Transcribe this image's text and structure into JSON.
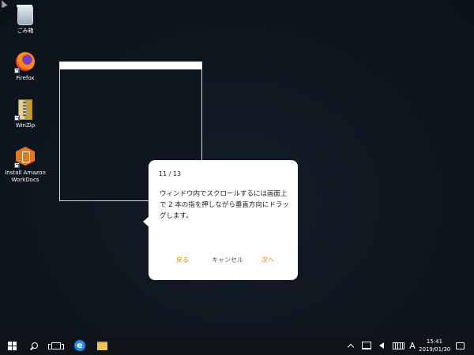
{
  "desktop": {
    "icons": [
      {
        "label": "ごみ箱",
        "icon": "recycle-bin-icon"
      },
      {
        "label": "Firefox",
        "icon": "firefox-icon"
      },
      {
        "label": "WinZip",
        "icon": "winzip-icon"
      },
      {
        "label": "Install Amazon WorkDocs",
        "icon": "workdocs-icon"
      }
    ]
  },
  "tutorial": {
    "step": "11 / 13",
    "message": "ウィンドウ内でスクロールするには画面上で 2 本の指を押しながら垂直方向にドラッグします。",
    "back_label": "戻る",
    "cancel_label": "キャンセル",
    "next_label": "次へ",
    "accent_color": "#e08a12"
  },
  "taskbar": {
    "time": "15:41",
    "date": "2019/01/30",
    "ime_indicator": "A"
  }
}
